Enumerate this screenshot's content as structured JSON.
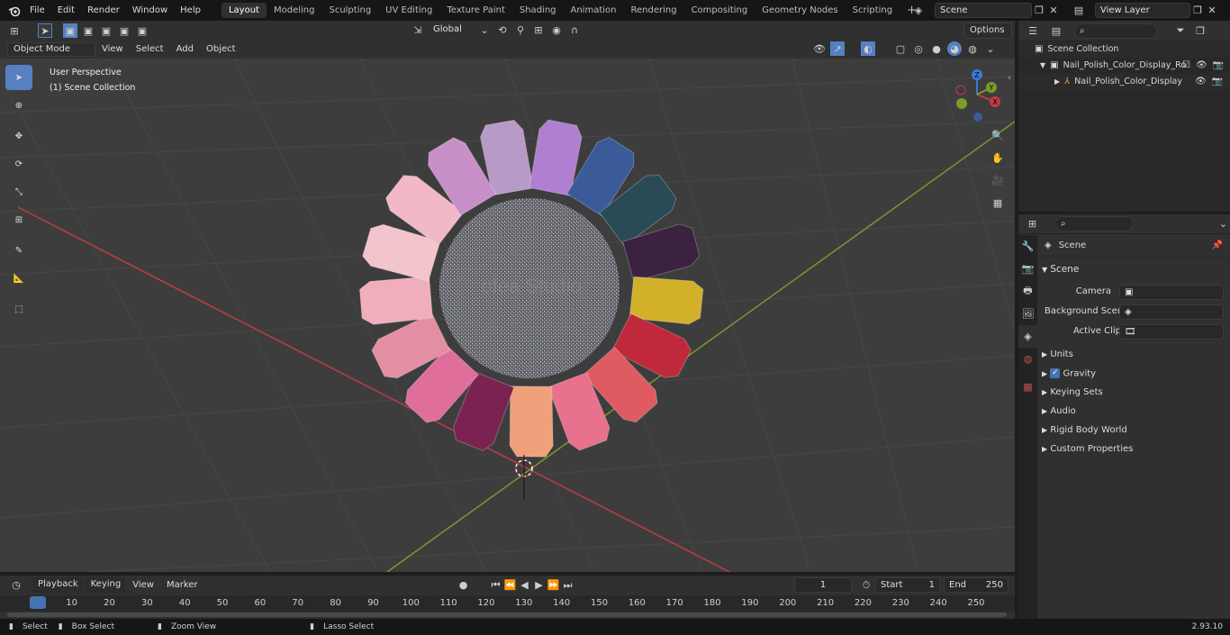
{
  "top_menu": [
    "File",
    "Edit",
    "Render",
    "Window",
    "Help"
  ],
  "workspaces": [
    "Layout",
    "Modeling",
    "Sculpting",
    "UV Editing",
    "Texture Paint",
    "Shading",
    "Animation",
    "Rendering",
    "Compositing",
    "Geometry Nodes",
    "Scripting"
  ],
  "active_workspace": "Layout",
  "scene_field": "Scene",
  "view_layer_field": "View Layer",
  "viewport_header": {
    "mode": "Object Mode",
    "menus": [
      "View",
      "Select",
      "Add",
      "Object"
    ],
    "orientation": "Global",
    "options_label": "Options"
  },
  "viewport_overlay": {
    "perspective": "User Perspective",
    "collection": "(1) Scene Collection",
    "watermark": "ofea Studio"
  },
  "outliner": {
    "root": "Scene Collection",
    "items": [
      {
        "label": "Nail_Polish_Color_Display_Ro"
      },
      {
        "label": "Nail_Polish_Color_Display"
      }
    ]
  },
  "properties": {
    "header": "Scene",
    "panel": "Scene",
    "fields": [
      {
        "label": "Camera"
      },
      {
        "label": "Background Scene"
      },
      {
        "label": "Active Clip"
      }
    ],
    "sections": [
      "Units",
      "Gravity",
      "Keying Sets",
      "Audio",
      "Rigid Body World",
      "Custom Properties"
    ],
    "gravity_checked": true
  },
  "timeline": {
    "menus": [
      "Playback",
      "Keying",
      "View",
      "Marker"
    ],
    "current_frame": "1",
    "start_label": "Start",
    "start": "1",
    "end_label": "End",
    "end": "250",
    "ticks": [
      "1",
      "10",
      "20",
      "30",
      "40",
      "50",
      "60",
      "70",
      "80",
      "90",
      "100",
      "110",
      "120",
      "130",
      "140",
      "150",
      "160",
      "170",
      "180",
      "190",
      "200",
      "210",
      "220",
      "230",
      "240",
      "250"
    ]
  },
  "statusbar": {
    "items": [
      "Select",
      "Box Select",
      "Zoom View",
      "Lasso Select"
    ],
    "version": "2.93.10"
  },
  "colors": {
    "accent": "#5680c2",
    "active_frame": "#4772b3",
    "x_axis": "#c03c45",
    "y_axis": "#7b9a2a"
  },
  "swatch_colors": [
    "#b89ac8",
    "#b07fcf",
    "#3b5a9a",
    "#2a4a58",
    "#3a2240",
    "#d2b02a",
    "#c0283c",
    "#e05a62",
    "#e8718e",
    "#f0a07a",
    "#7a2350",
    "#e06e9a",
    "#e48ea4",
    "#f0aebc",
    "#f2c4cc",
    "#f2b8c8",
    "#c890c8"
  ]
}
